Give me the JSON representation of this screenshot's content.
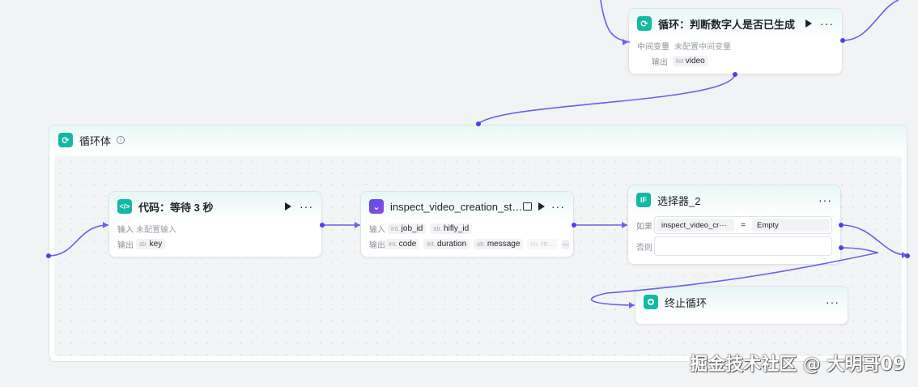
{
  "loop_node": {
    "title": "循环：判断数字人是否已生成",
    "mid_var_label": "中间变量",
    "mid_var_value": "未配置中间变量",
    "output_label": "输出",
    "output_type": "list",
    "output_name": "video"
  },
  "loop_body": {
    "title": "循环体"
  },
  "code_node": {
    "title": "代码：等待 3 秒",
    "input_label": "输入",
    "input_value": "未配置输入",
    "output_label": "输出",
    "output_type": "str.",
    "output_name": "key"
  },
  "inspect_node": {
    "title": "inspect_video_creation_sta···",
    "input_label": "输入",
    "inputs": [
      {
        "type": "int.",
        "name": "job_id"
      },
      {
        "type": "str.",
        "name": "hifly_id"
      }
    ],
    "output_label": "输出",
    "outputs": [
      {
        "type": "int.",
        "name": "code"
      },
      {
        "type": "int.",
        "name": "duration"
      },
      {
        "type": "str.",
        "name": "message"
      },
      {
        "type": "str.",
        "name": "re..."
      }
    ],
    "more": "···"
  },
  "selector_node": {
    "title": "选择器_2",
    "if_label": "如果",
    "cond_left": "inspect_video_cr···",
    "cond_op": "=",
    "cond_right": "Empty",
    "else_label": "否则"
  },
  "end_node": {
    "title": "终止循环"
  },
  "icons": {
    "loop": "loop-icon",
    "code": "code-icon",
    "plugin": "plugin-icon",
    "if": "if-icon",
    "stop": "stop-circle-icon"
  },
  "colors": {
    "accent": "#4e40e5",
    "teal": "#14b8a6"
  },
  "watermark": "掘金技术社区 @ 大明哥09"
}
